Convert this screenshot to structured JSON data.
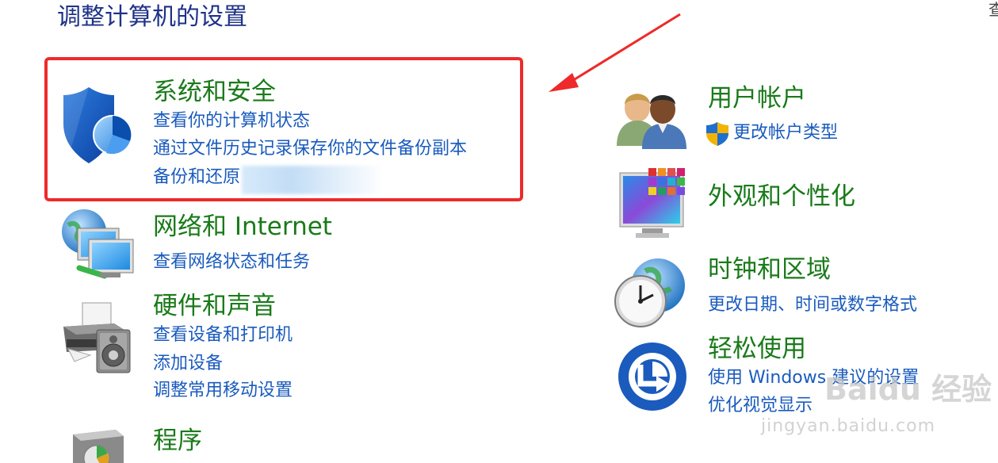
{
  "page": {
    "title": "调整计算机的设置",
    "corner_glyph": "查"
  },
  "left_categories": [
    {
      "title": "系统和安全",
      "icon": "shield-icon",
      "links": [
        "查看你的计算机状态",
        "通过文件历史记录保存你的文件备份副本",
        "备份和还原"
      ]
    },
    {
      "title": "网络和 Internet",
      "icon": "network-globe-icon",
      "links": [
        "查看网络状态和任务"
      ]
    },
    {
      "title": "硬件和声音",
      "icon": "printer-speaker-icon",
      "links": [
        "查看设备和打印机",
        "添加设备",
        "调整常用移动设置"
      ]
    },
    {
      "title": "程序",
      "icon": "programs-icon",
      "links": []
    }
  ],
  "right_categories": [
    {
      "title": "用户帐户",
      "icon": "users-icon",
      "links": [
        "更改帐户类型"
      ]
    },
    {
      "title": "外观和个性化",
      "icon": "appearance-monitor-icon",
      "links": []
    },
    {
      "title": "时钟和区域",
      "icon": "clock-globe-icon",
      "links": [
        "更改日期、时间或数字格式"
      ]
    },
    {
      "title": "轻松使用",
      "icon": "ease-of-access-icon",
      "links": [
        "使用 Windows 建议的设置",
        "优化视觉显示"
      ]
    }
  ],
  "watermark": {
    "brand": "Baidu 经验",
    "url": "jingyan.baidu.com"
  },
  "colors": {
    "title": "#1e3287",
    "category": "#1a7a1a",
    "link": "#1a5bbd",
    "highlight": "#ee2a2a"
  }
}
